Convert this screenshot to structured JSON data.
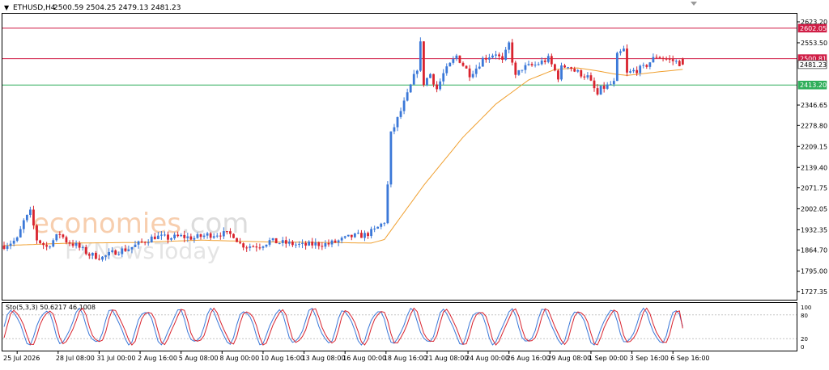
{
  "header": {
    "menu_arrow": "▼",
    "symbol_text": "ETHUSD,H4",
    "ohlc_text": "2500.59 2504.25 2479.13 2481.23"
  },
  "watermark": {
    "brand_text": "economies",
    "brand_suffix": ".com",
    "sub_text": "FXNewsToday"
  },
  "colors": {
    "bull": "#3b78d8",
    "bear": "#d9232e",
    "ma": "#f0a030",
    "resistance": "#d01c45",
    "support": "#2fae5a",
    "stoch_main": "#3b78d8",
    "stoch_signal": "#d9232e",
    "frame": "#000000",
    "grid_dash": "#c4c4c4"
  },
  "chart_data": {
    "type": "candlestick",
    "symbol": "ETHUSD",
    "timeframe": "H4",
    "ohlc_last": {
      "open": 2500.59,
      "high": 2504.25,
      "low": 2479.13,
      "close": 2481.23
    },
    "y_ticks": [
      "2623.20",
      "2553.50",
      "2346.65",
      "2278.80",
      "2209.15",
      "2139.40",
      "2071.75",
      "2002.05",
      "1932.35",
      "1864.70",
      "1795.00",
      "1727.35"
    ],
    "ylim": [
      1700,
      2650
    ],
    "x_labels": [
      "25 Jul 2026",
      "28 Jul 08:00",
      "31 Jul 00:00",
      "2 Aug 16:00",
      "5 Aug 08:00",
      "8 Aug 00:00",
      "10 Aug 16:00",
      "13 Aug 08:00",
      "16 Aug 00:00",
      "18 Aug 16:00",
      "21 Aug 08:00",
      "24 Aug 00:00",
      "26 Aug 16:00",
      "29 Aug 08:00",
      "1 Sep 00:00",
      "3 Sep 16:00",
      "6 Sep 16:00"
    ],
    "horizontal_levels": [
      {
        "value": 2602.05,
        "label": "2602.05",
        "role": "resistance"
      },
      {
        "value": 2500.81,
        "label": "2500.81",
        "role": "resistance"
      },
      {
        "value": 2481.23,
        "label": "2481.23",
        "role": "price"
      },
      {
        "value": 2413.2,
        "label": "2413.20",
        "role": "support"
      }
    ],
    "close_path": [
      [
        0,
        1880
      ],
      [
        4,
        1900
      ],
      [
        6,
        1960
      ],
      [
        8,
        1990
      ],
      [
        10,
        1900
      ],
      [
        13,
        1875
      ],
      [
        17,
        1920
      ],
      [
        19,
        1895
      ],
      [
        22,
        1880
      ],
      [
        26,
        1850
      ],
      [
        30,
        1840
      ],
      [
        34,
        1860
      ],
      [
        38,
        1870
      ],
      [
        42,
        1890
      ],
      [
        46,
        1910
      ],
      [
        50,
        1905
      ],
      [
        54,
        1910
      ],
      [
        58,
        1905
      ],
      [
        62,
        1915
      ],
      [
        66,
        1920
      ],
      [
        70,
        1915
      ],
      [
        72,
        1885
      ],
      [
        74,
        1878
      ],
      [
        78,
        1880
      ],
      [
        81,
        1895
      ],
      [
        84,
        1890
      ],
      [
        88,
        1885
      ],
      [
        91,
        1880
      ],
      [
        95,
        1885
      ],
      [
        99,
        1885
      ],
      [
        102,
        1895
      ],
      [
        106,
        1910
      ],
      [
        110,
        1915
      ],
      [
        113,
        1930
      ],
      [
        116,
        1960
      ],
      [
        117,
        2080
      ],
      [
        118,
        2250
      ],
      [
        120,
        2300
      ],
      [
        123,
        2380
      ],
      [
        126,
        2470
      ],
      [
        127,
        2550
      ],
      [
        128,
        2420
      ],
      [
        130,
        2450
      ],
      [
        132,
        2400
      ],
      [
        134,
        2450
      ],
      [
        138,
        2510
      ],
      [
        142,
        2450
      ],
      [
        144,
        2470
      ],
      [
        146,
        2500
      ],
      [
        150,
        2520
      ],
      [
        152,
        2490
      ],
      [
        154,
        2550
      ],
      [
        156,
        2440
      ],
      [
        158,
        2470
      ],
      [
        162,
        2480
      ],
      [
        166,
        2500
      ],
      [
        169,
        2440
      ],
      [
        170,
        2470
      ],
      [
        172,
        2480
      ],
      [
        174,
        2460
      ],
      [
        178,
        2440
      ],
      [
        181,
        2380
      ],
      [
        182,
        2400
      ],
      [
        184,
        2410
      ],
      [
        186,
        2420
      ],
      [
        187,
        2510
      ],
      [
        189,
        2530
      ],
      [
        190,
        2450
      ],
      [
        192,
        2460
      ],
      [
        195,
        2470
      ],
      [
        199,
        2510
      ],
      [
        202,
        2500
      ],
      [
        205,
        2490
      ],
      [
        207,
        2481.23
      ]
    ],
    "ma_path": [
      [
        0,
        1880
      ],
      [
        20,
        1888
      ],
      [
        40,
        1890
      ],
      [
        60,
        1898
      ],
      [
        80,
        1892
      ],
      [
        100,
        1890
      ],
      [
        112,
        1888
      ],
      [
        116,
        1900
      ],
      [
        120,
        1960
      ],
      [
        128,
        2080
      ],
      [
        140,
        2240
      ],
      [
        150,
        2350
      ],
      [
        160,
        2430
      ],
      [
        168,
        2465
      ],
      [
        175,
        2470
      ],
      [
        180,
        2462
      ],
      [
        186,
        2450
      ],
      [
        190,
        2445
      ],
      [
        198,
        2455
      ],
      [
        207,
        2465
      ]
    ],
    "indicator": {
      "name": "Sto(5,3,3)",
      "label_text": "Sto(5,3,3) 50.6217 46.1008",
      "main_value": 50.6217,
      "signal_value": 46.1008,
      "ylim": [
        0,
        100
      ],
      "ticks": [
        "100",
        "80",
        "20",
        "0"
      ],
      "levels": [
        80,
        20
      ]
    }
  }
}
